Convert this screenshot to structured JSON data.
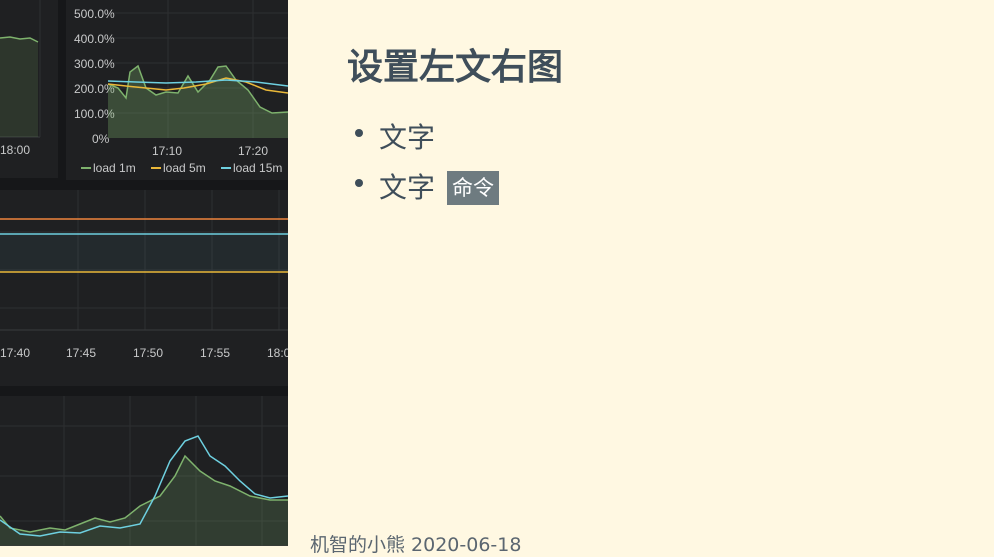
{
  "slide": {
    "title": "设置左文右图",
    "bullets": [
      {
        "text": "文字"
      },
      {
        "text": "文字",
        "code": "命令"
      }
    ],
    "footer": "机智的小熊 2020-06-18"
  },
  "left_image": {
    "top_left_panel": {
      "x_ticks": [
        "18:00"
      ]
    },
    "top_right_panel": {
      "y_ticks": [
        "500.0%",
        "400.0%",
        "300.0%",
        "200.0%",
        "100.0%",
        "0%"
      ],
      "x_ticks": [
        "17:10",
        "17:20"
      ],
      "legend": [
        {
          "label": "load 1m",
          "color": "#7eb26d"
        },
        {
          "label": "load 5m",
          "color": "#eab839"
        },
        {
          "label": "load 15m",
          "color": "#6ed0e0"
        }
      ]
    },
    "middle_panel": {
      "x_ticks": [
        "17:40",
        "17:45",
        "17:50",
        "17:55",
        "18:0"
      ]
    },
    "bottom_panel": {}
  },
  "colors": {
    "background": "#fff8e2",
    "text": "#3f4e5a",
    "code_bg": "#6e7b80"
  }
}
